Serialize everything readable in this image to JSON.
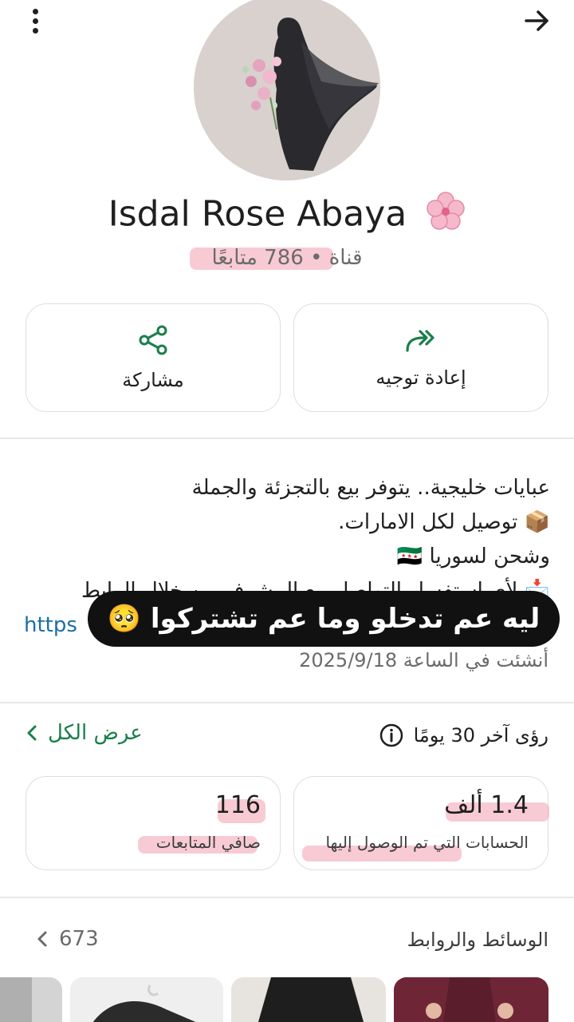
{
  "header": {
    "menu_icon": "more-vertical-icon",
    "back_icon": "arrow-right-icon"
  },
  "channel": {
    "name": "Isdal Rose Abaya",
    "name_emoji": "🌸",
    "meta": "قناة • 786 متابعًا"
  },
  "actions": {
    "share_label": "مشاركة",
    "forward_label": "إعادة توجيه"
  },
  "description": {
    "line1": "عبايات خليجية.. يتوفر بيع بالتجزئة والجملة",
    "line2": "📦 توصيل لكل الامارات.",
    "line3": "وشحن لسوريا 🇸🇾",
    "line4": "📩 لأي استفسار التواصل مع المشرف من خلال الرابط",
    "link": "https"
  },
  "created_text": "أنشئت في الساعة 2025/9/18",
  "overlay_caption": "ليه عم تدخلو وما عم تشتركوا 🥺",
  "insights": {
    "title": "رؤى آخر 30 يومًا",
    "view_all": "عرض الكل",
    "net_followers_value": "116",
    "net_followers_label": "صافي المتابعات",
    "accounts_reached_value": "1.4 ألف",
    "accounts_reached_label": "الحسابات التي تم الوصول إليها"
  },
  "media": {
    "title": "الوسائط والروابط",
    "count": "673"
  },
  "colors": {
    "accent_green": "#1a7f4b",
    "highlight_pink": "#f2a0b0",
    "link_blue": "#1b6fa8"
  }
}
